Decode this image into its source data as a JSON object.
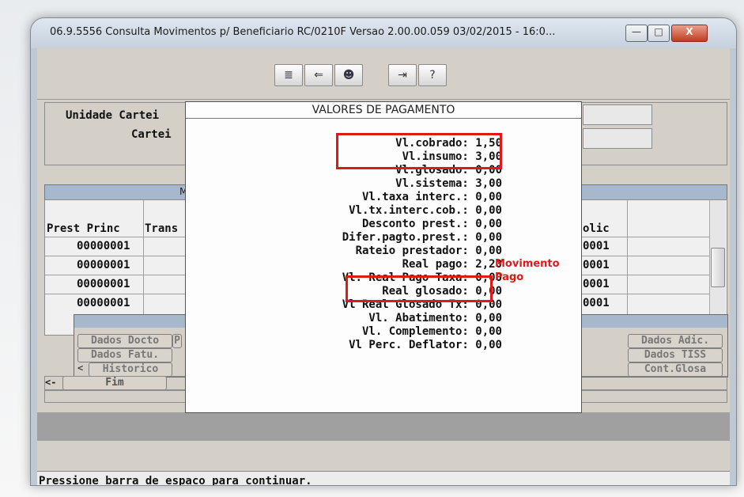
{
  "window": {
    "title": "06.9.5556 Consulta Movimentos p/ Beneficiario RC/0210F Versao 2.00.00.059 03/02/2015 - 16:0...",
    "buttons": {
      "minimize": "—",
      "maximize": "□",
      "close": "X"
    }
  },
  "toolbar": {
    "icons": [
      "list-icon",
      "list-back-icon",
      "person-icon",
      "exit-door-icon",
      "help-icon"
    ]
  },
  "form": {
    "unidade_label": "Unidade Cartei",
    "carteira_label": "Cartei"
  },
  "grid": {
    "header_fragment": "M",
    "columns": [
      "Prest Princ",
      "Trans",
      "olic"
    ],
    "rows": [
      {
        "prest": "00000001",
        "olic": "0001"
      },
      {
        "prest": "00000001",
        "olic": "0001"
      },
      {
        "prest": "00000001",
        "olic": "0001"
      },
      {
        "prest": "00000001",
        "olic": "0001"
      }
    ]
  },
  "buttons": {
    "dados_docto": "Dados Docto",
    "p_fragment": "P",
    "dados_fatu": "Dados Fatu.",
    "historico": "Historico",
    "fim": "Fim",
    "dados_adic": "Dados Adic.",
    "dados_tiss": "Dados TISS",
    "cont_glosa": "Cont.Glosa",
    "left_arrow": "<",
    "left_double": "<-"
  },
  "popup": {
    "title": "VALORES DE PAGAMENTO",
    "lines": [
      "Vl.cobrado: 1,50",
      "Vl.insumo: 3,00",
      "Vl.glosado: 0,00",
      "Vl.sistema: 3,00",
      "Vl.taxa interc.: 0,00",
      "Vl.tx.interc.cob.: 0,00",
      "Desconto prest.: 0,00",
      "Difer.pagto.prest.: 0,00",
      "Rateio prestador: 0,00",
      "Real pago: 2,20",
      "Vl. Real Pago Taxa: 0,00",
      "Real glosado: 0,00",
      "Vl Real Glosado Tx: 0,00",
      "Vl. Abatimento: 0,00",
      "Vl. Complemento: 0,00",
      "Vl Perc. Deflator: 0,00"
    ]
  },
  "annotation": {
    "line1": "Movimento",
    "line2": "Pago",
    "color": "#e01818"
  },
  "status": {
    "text": "Pressione barra de espaco para continuar."
  }
}
